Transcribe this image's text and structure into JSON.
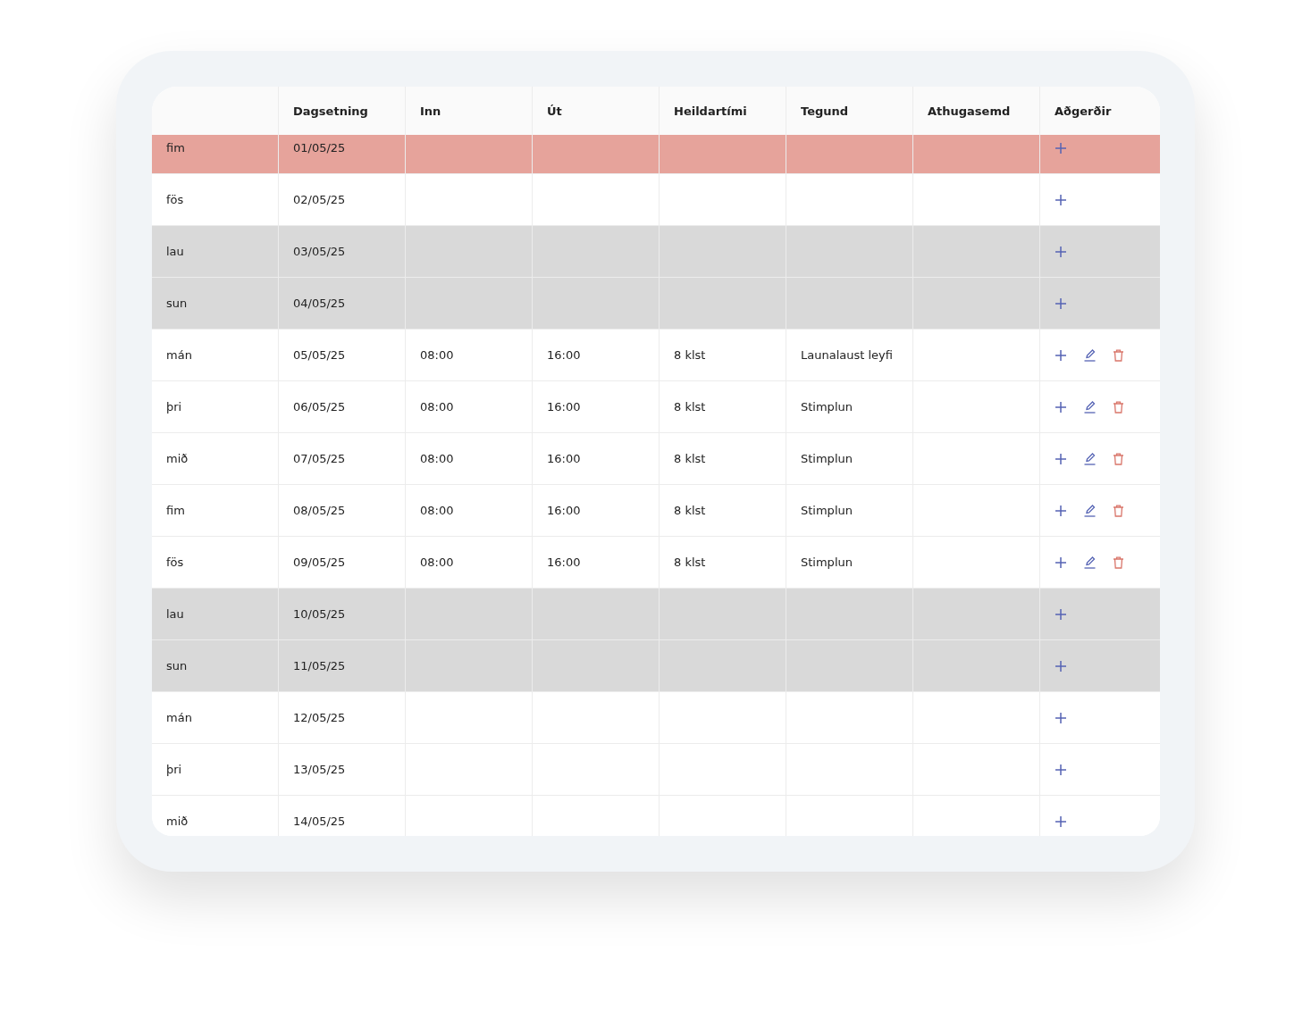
{
  "table": {
    "columns": [
      "",
      "Dagsetning",
      "Inn",
      "Út",
      "Heildartími",
      "Tegund",
      "Athugasemd",
      "Aðgerðir"
    ],
    "rows": [
      {
        "kind": "holiday",
        "day": "fim",
        "date": "01/05/25",
        "editable": false
      },
      {
        "kind": "workday",
        "day": "fös",
        "date": "02/05/25",
        "editable": false
      },
      {
        "kind": "weekend",
        "day": "lau",
        "date": "03/05/25",
        "editable": false
      },
      {
        "kind": "weekend",
        "day": "sun",
        "date": "04/05/25",
        "editable": false
      },
      {
        "kind": "workday",
        "day": "mán",
        "date": "05/05/25",
        "in": "08:00",
        "out": "16:00",
        "total": "8 klst",
        "type": "Launalaust leyfi",
        "editable": true
      },
      {
        "kind": "workday",
        "day": "þri",
        "date": "06/05/25",
        "in": "08:00",
        "out": "16:00",
        "total": "8 klst",
        "type": "Stimplun",
        "editable": true
      },
      {
        "kind": "workday",
        "day": "mið",
        "date": "07/05/25",
        "in": "08:00",
        "out": "16:00",
        "total": "8 klst",
        "type": "Stimplun",
        "editable": true
      },
      {
        "kind": "workday",
        "day": "fim",
        "date": "08/05/25",
        "in": "08:00",
        "out": "16:00",
        "total": "8 klst",
        "type": "Stimplun",
        "editable": true
      },
      {
        "kind": "workday",
        "day": "fös",
        "date": "09/05/25",
        "in": "08:00",
        "out": "16:00",
        "total": "8 klst",
        "type": "Stimplun",
        "editable": true
      },
      {
        "kind": "weekend",
        "day": "lau",
        "date": "10/05/25",
        "editable": false
      },
      {
        "kind": "weekend",
        "day": "sun",
        "date": "11/05/25",
        "editable": false
      },
      {
        "kind": "workday",
        "day": "mán",
        "date": "12/05/25",
        "editable": false
      },
      {
        "kind": "workday",
        "day": "þri",
        "date": "13/05/25",
        "editable": false
      },
      {
        "kind": "workday",
        "day": "mið",
        "date": "14/05/25",
        "editable": false
      }
    ]
  }
}
